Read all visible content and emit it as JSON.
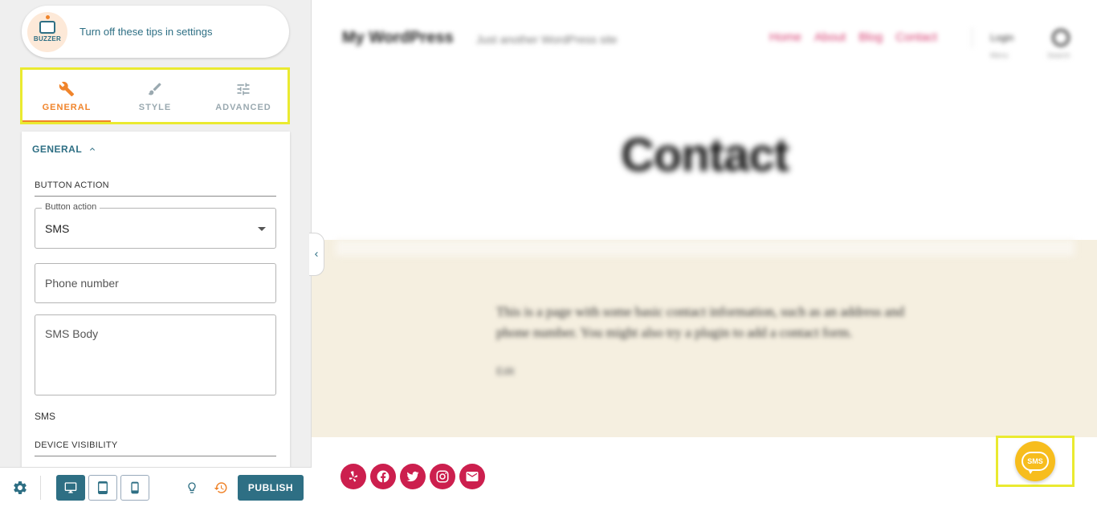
{
  "tip": {
    "logo_text": "BUZZER",
    "text": "Turn off these tips in settings"
  },
  "tabs": [
    {
      "label": "GENERAL",
      "icon": "wrench-icon",
      "active": true
    },
    {
      "label": "STYLE",
      "icon": "brush-icon",
      "active": false
    },
    {
      "label": "ADVANCED",
      "icon": "sliders-icon",
      "active": false
    }
  ],
  "panel": {
    "heading": "GENERAL",
    "button_action_section": "BUTTON ACTION",
    "button_action_legend": "Button action",
    "button_action_value": "SMS",
    "phone_placeholder": "Phone number",
    "sms_body_placeholder": "SMS Body",
    "sms_text": "SMS",
    "device_visibility_section": "DEVICE VISIBILITY"
  },
  "bottom_bar": {
    "publish_label": "PUBLISH"
  },
  "preview": {
    "site_title": "My WordPress",
    "site_tagline": "Just another WordPress site",
    "nav": [
      "Home",
      "About",
      "Blog",
      "Contact"
    ],
    "nav_extra": "Login",
    "nav_extra_sub": "Menu",
    "nav_search_label": "Search",
    "page_title": "Contact",
    "body_text": "This is a page with some basic contact information, such as an address and phone number. You might also try a plugin to add a contact form.",
    "edit_link": "Edit",
    "socials": [
      "yelp-icon",
      "facebook-icon",
      "twitter-icon",
      "instagram-icon",
      "mail-icon"
    ],
    "sms_button_label": "SMS"
  },
  "colors": {
    "accent": "#f0842b",
    "brand": "#2e6f84",
    "highlight": "#eaea30",
    "social": "#cc1f4e",
    "sms": "#f7bd1d"
  }
}
